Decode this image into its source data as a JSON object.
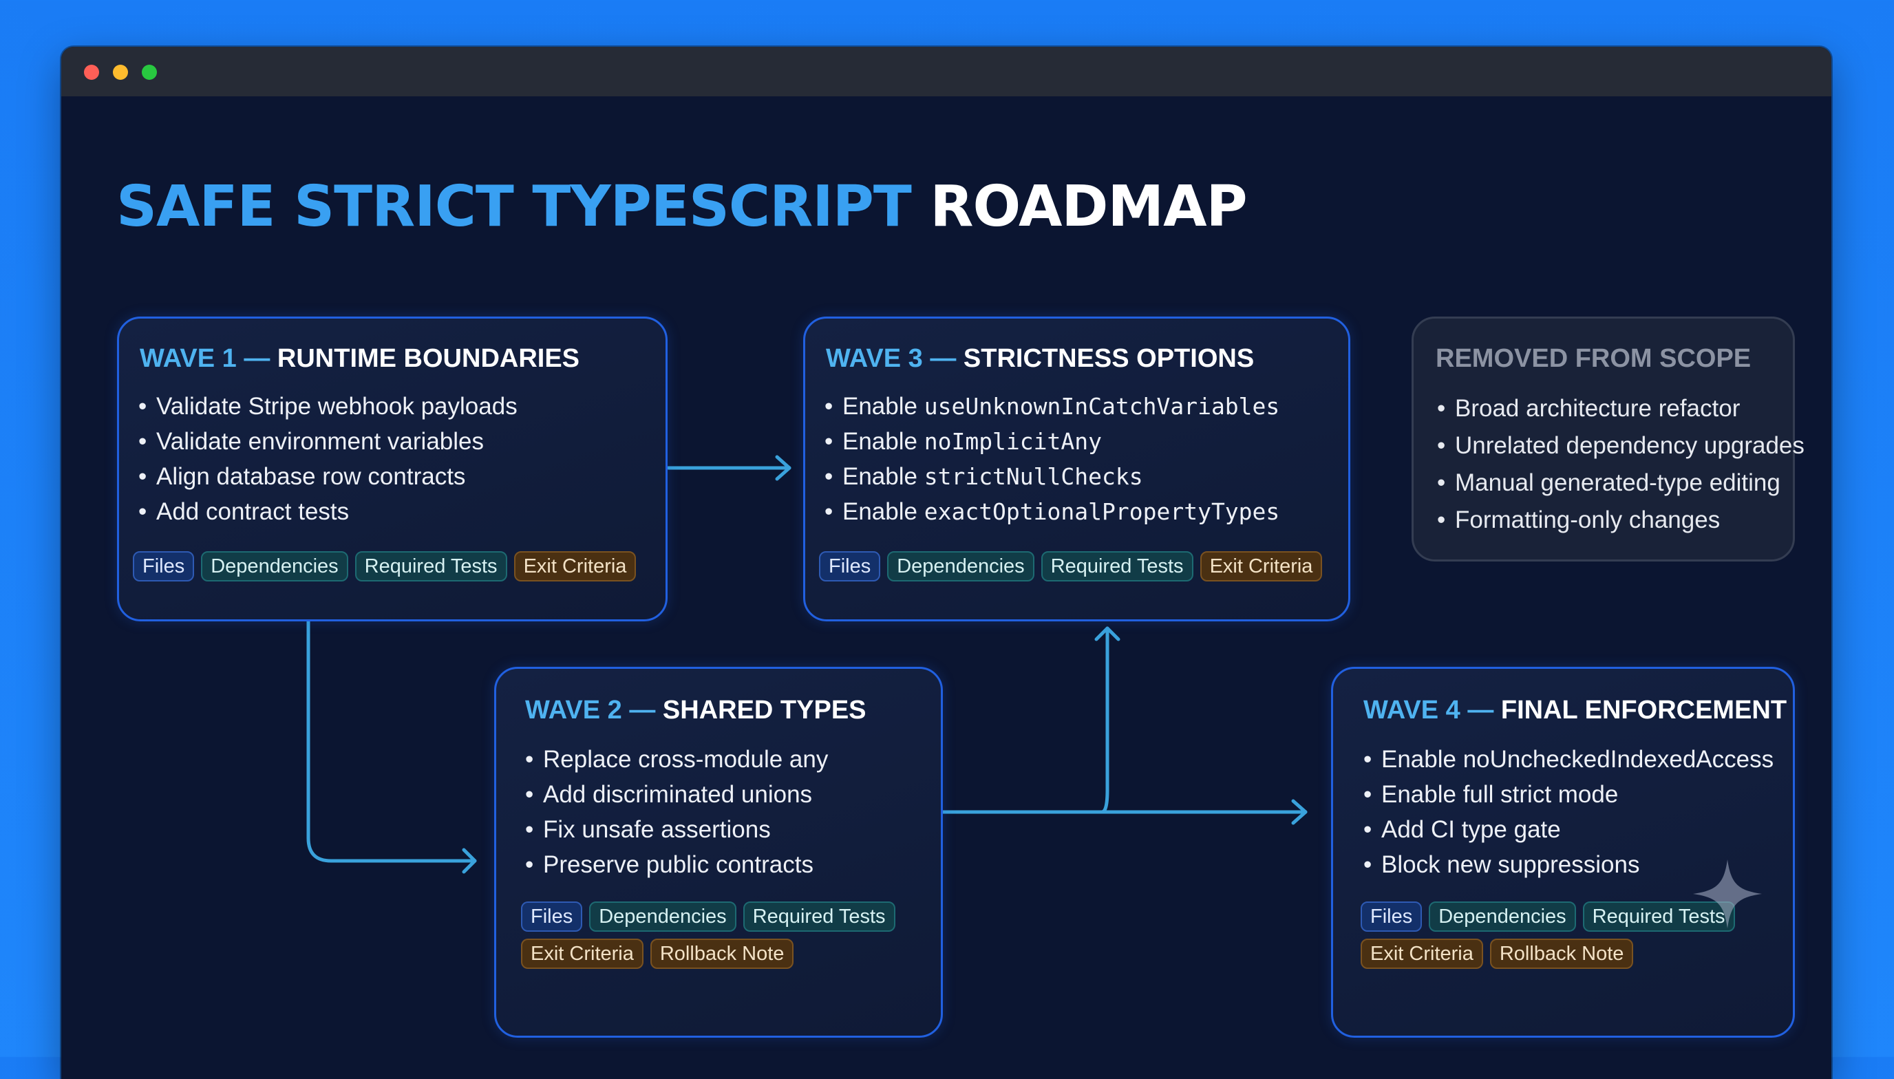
{
  "window": {
    "title_part1": "SAFE STRICT TYPESCRIPT",
    "title_part2": "ROADMAP"
  },
  "waves": [
    {
      "num": "WAVE 1",
      "dash": "—",
      "name": "RUNTIME BOUNDARIES",
      "items": [
        "Validate Stripe webhook payloads",
        "Validate environment variables",
        "Align database row contracts",
        "Add contract tests"
      ],
      "tags": [
        "Files",
        "Dependencies",
        "Required Tests",
        "Exit Criteria"
      ]
    },
    {
      "num": "WAVE 2",
      "dash": "—",
      "name": "SHARED TYPES",
      "items": [
        "Replace cross-module any",
        "Add discriminated unions",
        "Fix unsafe assertions",
        "Preserve public contracts"
      ],
      "tags": [
        "Files",
        "Dependencies",
        "Required Tests",
        "Exit Criteria",
        "Rollback Note"
      ]
    },
    {
      "num": "WAVE 3",
      "dash": "—",
      "name": "STRICTNESS OPTIONS",
      "items_prefix": "Enable",
      "items": [
        "useUnknownInCatchVariables",
        "noImplicitAny",
        "strictNullChecks",
        "exactOptionalPropertyTypes"
      ],
      "tags": [
        "Files",
        "Dependencies",
        "Required Tests",
        "Exit Criteria"
      ]
    },
    {
      "num": "WAVE 4",
      "dash": "—",
      "name": "FINAL ENFORCEMENT",
      "items": [
        "Enable noUncheckedIndexedAccess",
        "Enable full strict mode",
        "Add CI type gate",
        "Block new suppressions"
      ],
      "tags": [
        "Files",
        "Dependencies",
        "Required Tests",
        "Exit Criteria",
        "Rollback Note"
      ]
    }
  ],
  "removed": {
    "title": "REMOVED FROM SCOPE",
    "items": [
      "Broad architecture refactor",
      "Unrelated dependency upgrades",
      "Manual generated-type editing",
      "Formatting-only changes"
    ]
  },
  "colors": {
    "accent": "#39a0f2",
    "card_border": "#2160e0",
    "arrow": "#3aa2dc",
    "background": "#0b1531"
  }
}
